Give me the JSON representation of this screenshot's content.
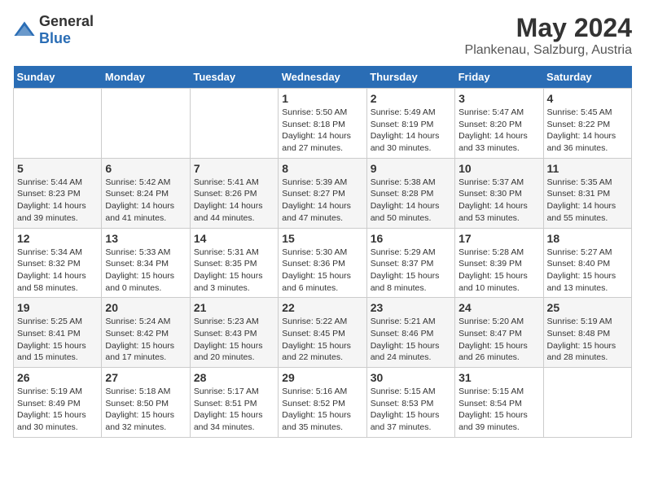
{
  "header": {
    "logo_general": "General",
    "logo_blue": "Blue",
    "title": "May 2024",
    "subtitle": "Plankenau, Salzburg, Austria"
  },
  "calendar": {
    "days_of_week": [
      "Sunday",
      "Monday",
      "Tuesday",
      "Wednesday",
      "Thursday",
      "Friday",
      "Saturday"
    ],
    "weeks": [
      [
        {
          "day": "",
          "info": ""
        },
        {
          "day": "",
          "info": ""
        },
        {
          "day": "",
          "info": ""
        },
        {
          "day": "1",
          "info": "Sunrise: 5:50 AM\nSunset: 8:18 PM\nDaylight: 14 hours and 27 minutes."
        },
        {
          "day": "2",
          "info": "Sunrise: 5:49 AM\nSunset: 8:19 PM\nDaylight: 14 hours and 30 minutes."
        },
        {
          "day": "3",
          "info": "Sunrise: 5:47 AM\nSunset: 8:20 PM\nDaylight: 14 hours and 33 minutes."
        },
        {
          "day": "4",
          "info": "Sunrise: 5:45 AM\nSunset: 8:22 PM\nDaylight: 14 hours and 36 minutes."
        }
      ],
      [
        {
          "day": "5",
          "info": "Sunrise: 5:44 AM\nSunset: 8:23 PM\nDaylight: 14 hours and 39 minutes."
        },
        {
          "day": "6",
          "info": "Sunrise: 5:42 AM\nSunset: 8:24 PM\nDaylight: 14 hours and 41 minutes."
        },
        {
          "day": "7",
          "info": "Sunrise: 5:41 AM\nSunset: 8:26 PM\nDaylight: 14 hours and 44 minutes."
        },
        {
          "day": "8",
          "info": "Sunrise: 5:39 AM\nSunset: 8:27 PM\nDaylight: 14 hours and 47 minutes."
        },
        {
          "day": "9",
          "info": "Sunrise: 5:38 AM\nSunset: 8:28 PM\nDaylight: 14 hours and 50 minutes."
        },
        {
          "day": "10",
          "info": "Sunrise: 5:37 AM\nSunset: 8:30 PM\nDaylight: 14 hours and 53 minutes."
        },
        {
          "day": "11",
          "info": "Sunrise: 5:35 AM\nSunset: 8:31 PM\nDaylight: 14 hours and 55 minutes."
        }
      ],
      [
        {
          "day": "12",
          "info": "Sunrise: 5:34 AM\nSunset: 8:32 PM\nDaylight: 14 hours and 58 minutes."
        },
        {
          "day": "13",
          "info": "Sunrise: 5:33 AM\nSunset: 8:34 PM\nDaylight: 15 hours and 0 minutes."
        },
        {
          "day": "14",
          "info": "Sunrise: 5:31 AM\nSunset: 8:35 PM\nDaylight: 15 hours and 3 minutes."
        },
        {
          "day": "15",
          "info": "Sunrise: 5:30 AM\nSunset: 8:36 PM\nDaylight: 15 hours and 6 minutes."
        },
        {
          "day": "16",
          "info": "Sunrise: 5:29 AM\nSunset: 8:37 PM\nDaylight: 15 hours and 8 minutes."
        },
        {
          "day": "17",
          "info": "Sunrise: 5:28 AM\nSunset: 8:39 PM\nDaylight: 15 hours and 10 minutes."
        },
        {
          "day": "18",
          "info": "Sunrise: 5:27 AM\nSunset: 8:40 PM\nDaylight: 15 hours and 13 minutes."
        }
      ],
      [
        {
          "day": "19",
          "info": "Sunrise: 5:25 AM\nSunset: 8:41 PM\nDaylight: 15 hours and 15 minutes."
        },
        {
          "day": "20",
          "info": "Sunrise: 5:24 AM\nSunset: 8:42 PM\nDaylight: 15 hours and 17 minutes."
        },
        {
          "day": "21",
          "info": "Sunrise: 5:23 AM\nSunset: 8:43 PM\nDaylight: 15 hours and 20 minutes."
        },
        {
          "day": "22",
          "info": "Sunrise: 5:22 AM\nSunset: 8:45 PM\nDaylight: 15 hours and 22 minutes."
        },
        {
          "day": "23",
          "info": "Sunrise: 5:21 AM\nSunset: 8:46 PM\nDaylight: 15 hours and 24 minutes."
        },
        {
          "day": "24",
          "info": "Sunrise: 5:20 AM\nSunset: 8:47 PM\nDaylight: 15 hours and 26 minutes."
        },
        {
          "day": "25",
          "info": "Sunrise: 5:19 AM\nSunset: 8:48 PM\nDaylight: 15 hours and 28 minutes."
        }
      ],
      [
        {
          "day": "26",
          "info": "Sunrise: 5:19 AM\nSunset: 8:49 PM\nDaylight: 15 hours and 30 minutes."
        },
        {
          "day": "27",
          "info": "Sunrise: 5:18 AM\nSunset: 8:50 PM\nDaylight: 15 hours and 32 minutes."
        },
        {
          "day": "28",
          "info": "Sunrise: 5:17 AM\nSunset: 8:51 PM\nDaylight: 15 hours and 34 minutes."
        },
        {
          "day": "29",
          "info": "Sunrise: 5:16 AM\nSunset: 8:52 PM\nDaylight: 15 hours and 35 minutes."
        },
        {
          "day": "30",
          "info": "Sunrise: 5:15 AM\nSunset: 8:53 PM\nDaylight: 15 hours and 37 minutes."
        },
        {
          "day": "31",
          "info": "Sunrise: 5:15 AM\nSunset: 8:54 PM\nDaylight: 15 hours and 39 minutes."
        },
        {
          "day": "",
          "info": ""
        }
      ]
    ]
  }
}
